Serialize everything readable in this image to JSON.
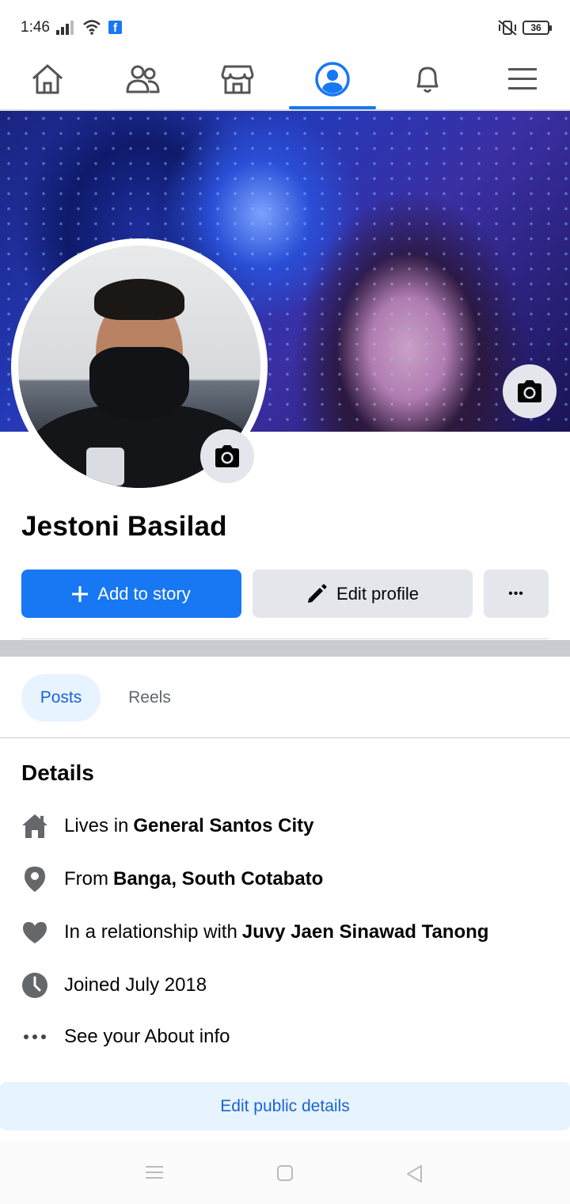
{
  "status_bar": {
    "time": "1:46",
    "battery": "36"
  },
  "nav": {
    "active_tab": "profile",
    "accent": "#1877f2"
  },
  "profile": {
    "name": "Jestoni Basilad"
  },
  "actions": {
    "add_story": "Add to story",
    "edit_profile": "Edit profile",
    "more": "•••"
  },
  "tabs": [
    {
      "label": "Posts",
      "selected": true
    },
    {
      "label": "Reels",
      "selected": false
    }
  ],
  "details": {
    "heading": "Details",
    "lives_in_prefix": "Lives in",
    "lives_in_value": "General Santos City",
    "from_prefix": "From",
    "from_value": "Banga, South Cotabato",
    "relationship_prefix": "In a relationship with",
    "relationship_value": "Juvy Jaen Sinawad Tanong",
    "joined": "Joined July 2018",
    "see_about": "See your About info"
  },
  "edit_public_details": "Edit public details",
  "icons": [
    "home-icon",
    "friends-icon",
    "marketplace-icon",
    "profile-icon",
    "bell-icon",
    "menu-icon",
    "camera-icon",
    "plus-icon",
    "pencil-icon",
    "house-icon",
    "location-pin-icon",
    "heart-icon",
    "clock-icon",
    "more-dots-icon"
  ]
}
